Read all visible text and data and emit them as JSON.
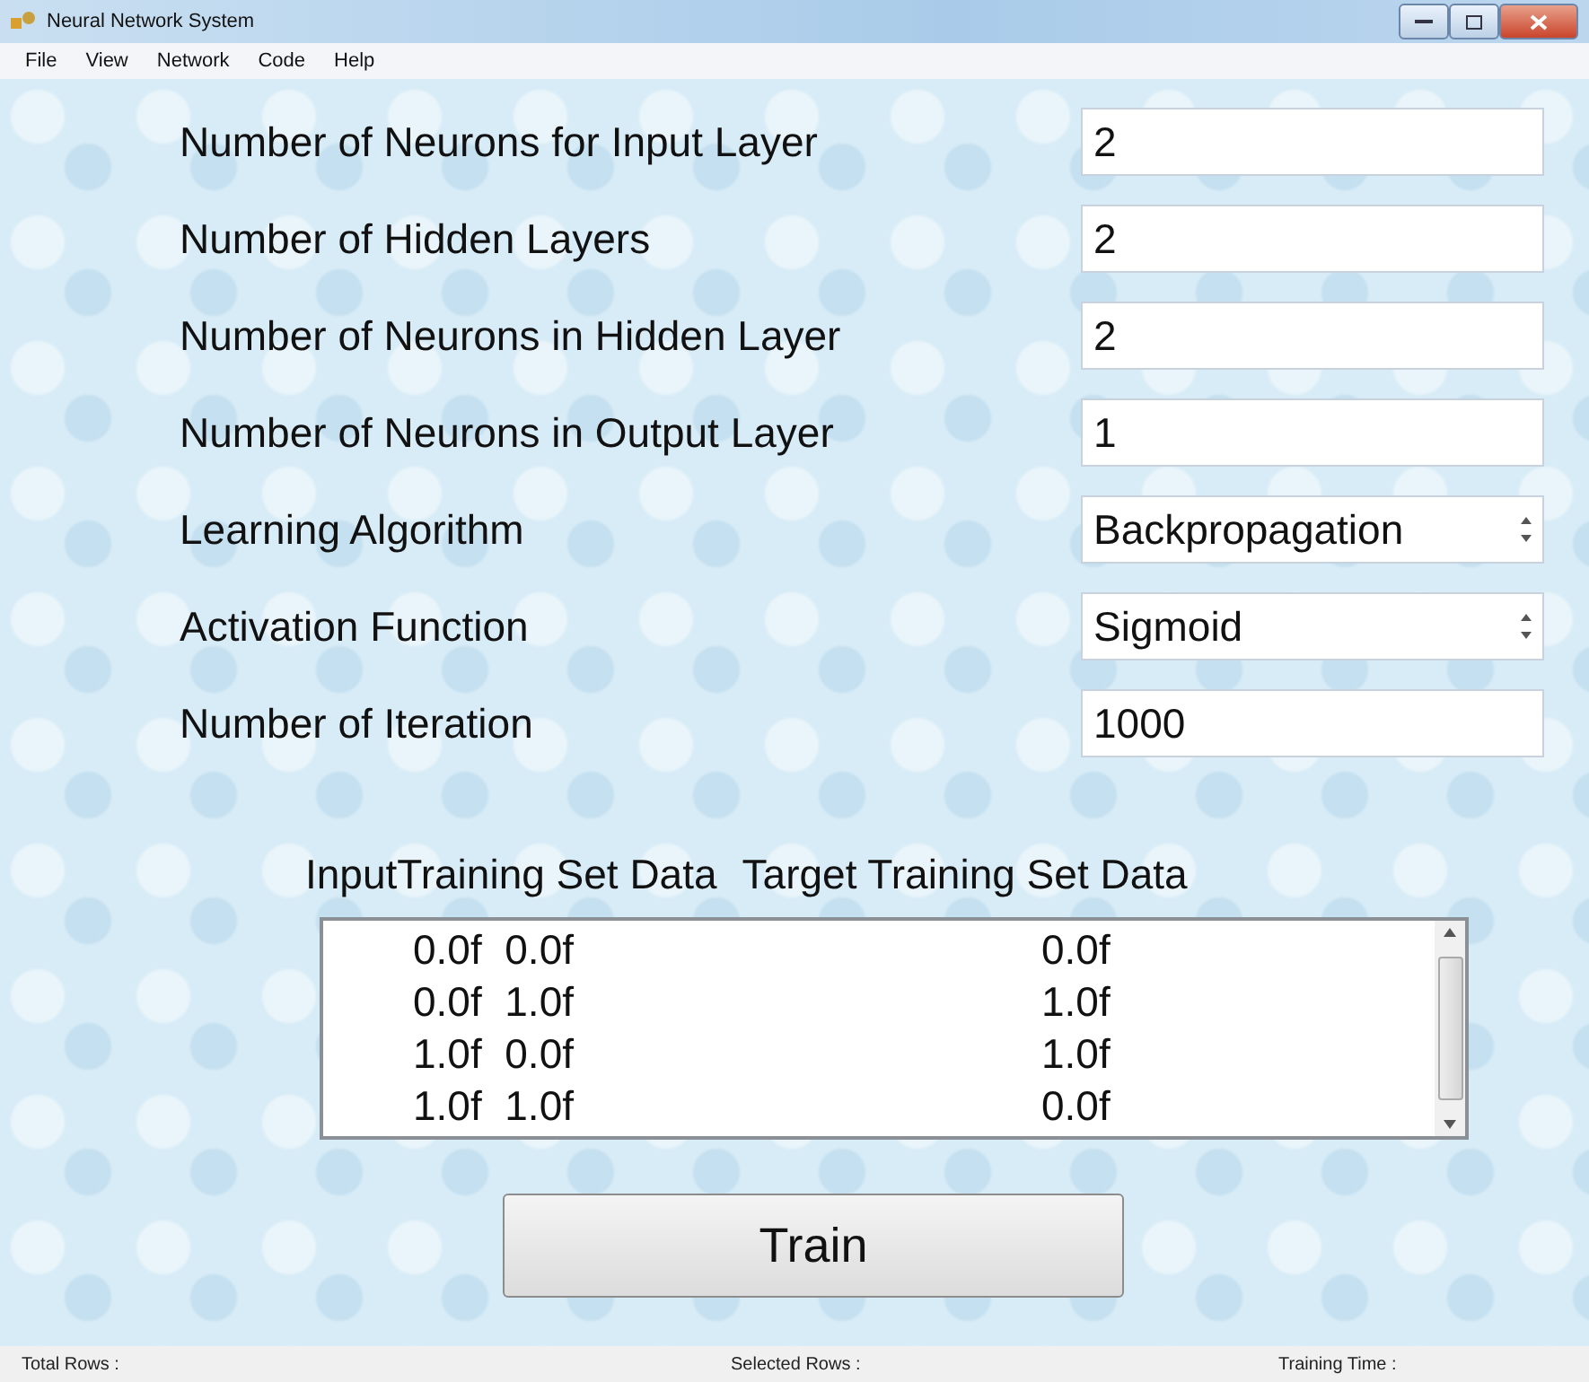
{
  "window": {
    "title": "Neural Network System"
  },
  "menu": [
    "File",
    "View",
    "Network",
    "Code",
    "Help"
  ],
  "fields": [
    {
      "label": "Number of Neurons for Input Layer",
      "value": "2",
      "kind": "text"
    },
    {
      "label": "Number of Hidden Layers",
      "value": "2",
      "kind": "text"
    },
    {
      "label": "Number of Neurons in Hidden Layer",
      "value": "2",
      "kind": "text"
    },
    {
      "label": "Number of Neurons in Output Layer",
      "value": "1",
      "kind": "text"
    },
    {
      "label": "Learning Algorithm",
      "value": "Backpropagation",
      "kind": "spinner"
    },
    {
      "label": "Activation Function",
      "value": "Sigmoid",
      "kind": "spinner"
    },
    {
      "label": "Number of Iteration",
      "value": "1000",
      "kind": "text"
    }
  ],
  "training": {
    "headers": [
      "InputTraining Set Data",
      "Target Training Set Data"
    ],
    "rows": [
      {
        "input": "0.0f  0.0f",
        "target": "0.0f"
      },
      {
        "input": "0.0f  1.0f",
        "target": "1.0f"
      },
      {
        "input": "1.0f  0.0f",
        "target": "1.0f"
      },
      {
        "input": "1.0f  1.0f",
        "target": "0.0f"
      }
    ]
  },
  "train_button": "Train",
  "status_bar": [
    "Total Rows :",
    "Selected Rows :",
    "Training Time :"
  ]
}
